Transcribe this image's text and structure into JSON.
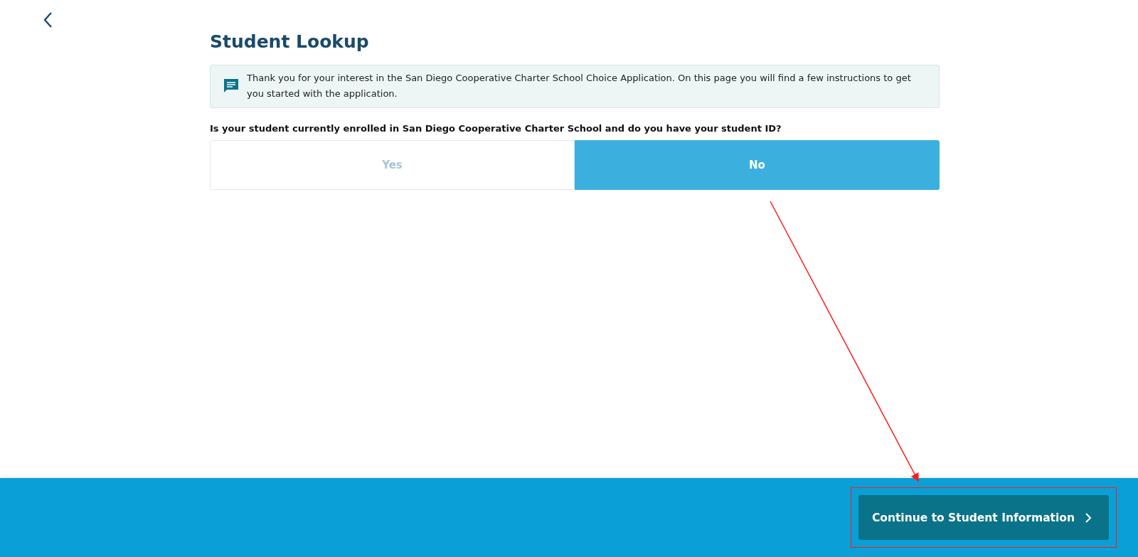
{
  "page": {
    "title": "Student Lookup"
  },
  "info": {
    "text": "Thank you for your interest in the San Diego Cooperative Charter School Choice Application. On this page you will find a few instructions to get you started with the application."
  },
  "question": {
    "label": "Is your student currently enrolled in San Diego Cooperative Charter School and do you have your student ID?",
    "options": [
      {
        "label": "Yes",
        "selected": false
      },
      {
        "label": "No",
        "selected": true
      }
    ]
  },
  "footer": {
    "continue_button": "Continue to Student Information"
  }
}
